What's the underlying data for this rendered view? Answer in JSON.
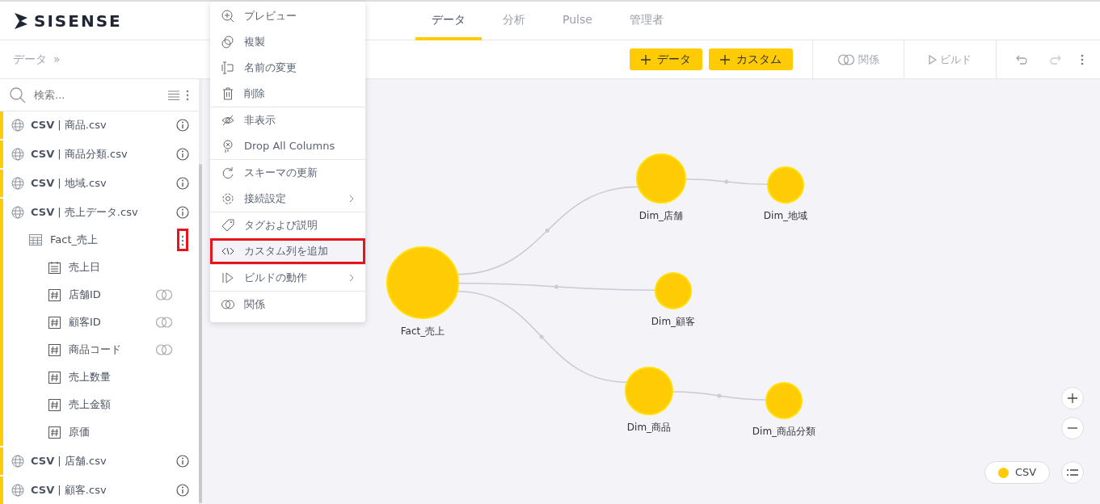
{
  "logo": {
    "text": "SISENSE"
  },
  "tabs": [
    {
      "label": "データ",
      "selected": true
    },
    {
      "label": "分析",
      "selected": false
    },
    {
      "label": "Pulse",
      "selected": false
    },
    {
      "label": "管理者",
      "selected": false
    }
  ],
  "breadcrumb": {
    "label": "データ",
    "separator": "»"
  },
  "toolbar": {
    "add_buttons": [
      {
        "label": "データ"
      },
      {
        "label": "カスタム"
      }
    ],
    "relations_button": "関係",
    "build_button": "ビルド"
  },
  "search": {
    "placeholder": "検索..."
  },
  "datasets": [
    {
      "label": "**CSV** | 商品.csv"
    },
    {
      "label": "**CSV** | 商品分類.csv"
    },
    {
      "label": "**CSV** | 地域.csv"
    },
    {
      "label": "**CSV** | 売上データ.csv",
      "tables": [
        {
          "label": "Fact_売上",
          "menu_open": true,
          "columns": [
            {
              "label": "売上日",
              "kind": "date",
              "linked": false
            },
            {
              "label": "店舗ID",
              "kind": "number",
              "linked": true
            },
            {
              "label": "顧客ID",
              "kind": "number",
              "linked": true
            },
            {
              "label": "商品コード",
              "kind": "number",
              "linked": true
            },
            {
              "label": "売上数量",
              "kind": "number",
              "linked": false
            },
            {
              "label": "売上金額",
              "kind": "number",
              "linked": false
            },
            {
              "label": "原価",
              "kind": "number",
              "linked": false
            }
          ]
        }
      ]
    },
    {
      "label": "**CSV** | 店舗.csv"
    },
    {
      "label": "**CSV** | 顧客.csv"
    }
  ],
  "context_menu": {
    "groups": [
      [
        {
          "label": "プレビュー",
          "submenu": false,
          "highlighted": false
        },
        {
          "label": "複製",
          "submenu": false,
          "highlighted": false
        },
        {
          "label": "名前の変更",
          "submenu": false,
          "highlighted": false
        },
        {
          "label": "削除",
          "submenu": false,
          "highlighted": false
        }
      ],
      [
        {
          "label": "非表示",
          "submenu": false,
          "highlighted": false
        },
        {
          "label": "Drop All Columns",
          "submenu": false,
          "highlighted": false
        }
      ],
      [
        {
          "label": "スキーマの更新",
          "submenu": false,
          "highlighted": false
        },
        {
          "label": "接続設定",
          "submenu": true,
          "highlighted": false
        }
      ],
      [
        {
          "label": "タグおよび説明",
          "submenu": false,
          "highlighted": false
        },
        {
          "label": "カスタム列を追加",
          "submenu": false,
          "highlighted": true
        }
      ],
      [
        {
          "label": "ビルドの動作",
          "submenu": true,
          "highlighted": false
        }
      ],
      [
        {
          "label": "関係",
          "submenu": false,
          "highlighted": false
        }
      ]
    ]
  },
  "diagram": {
    "nodes": [
      {
        "label": "Fact_売上"
      },
      {
        "label": "Dim_店舗"
      },
      {
        "label": "Dim_地域"
      },
      {
        "label": "Dim_顧客"
      },
      {
        "label": "Dim_商品"
      },
      {
        "label": "Dim_商品分類"
      }
    ],
    "legend": [
      {
        "label": "CSV",
        "color": "#ffcb05"
      }
    ]
  }
}
